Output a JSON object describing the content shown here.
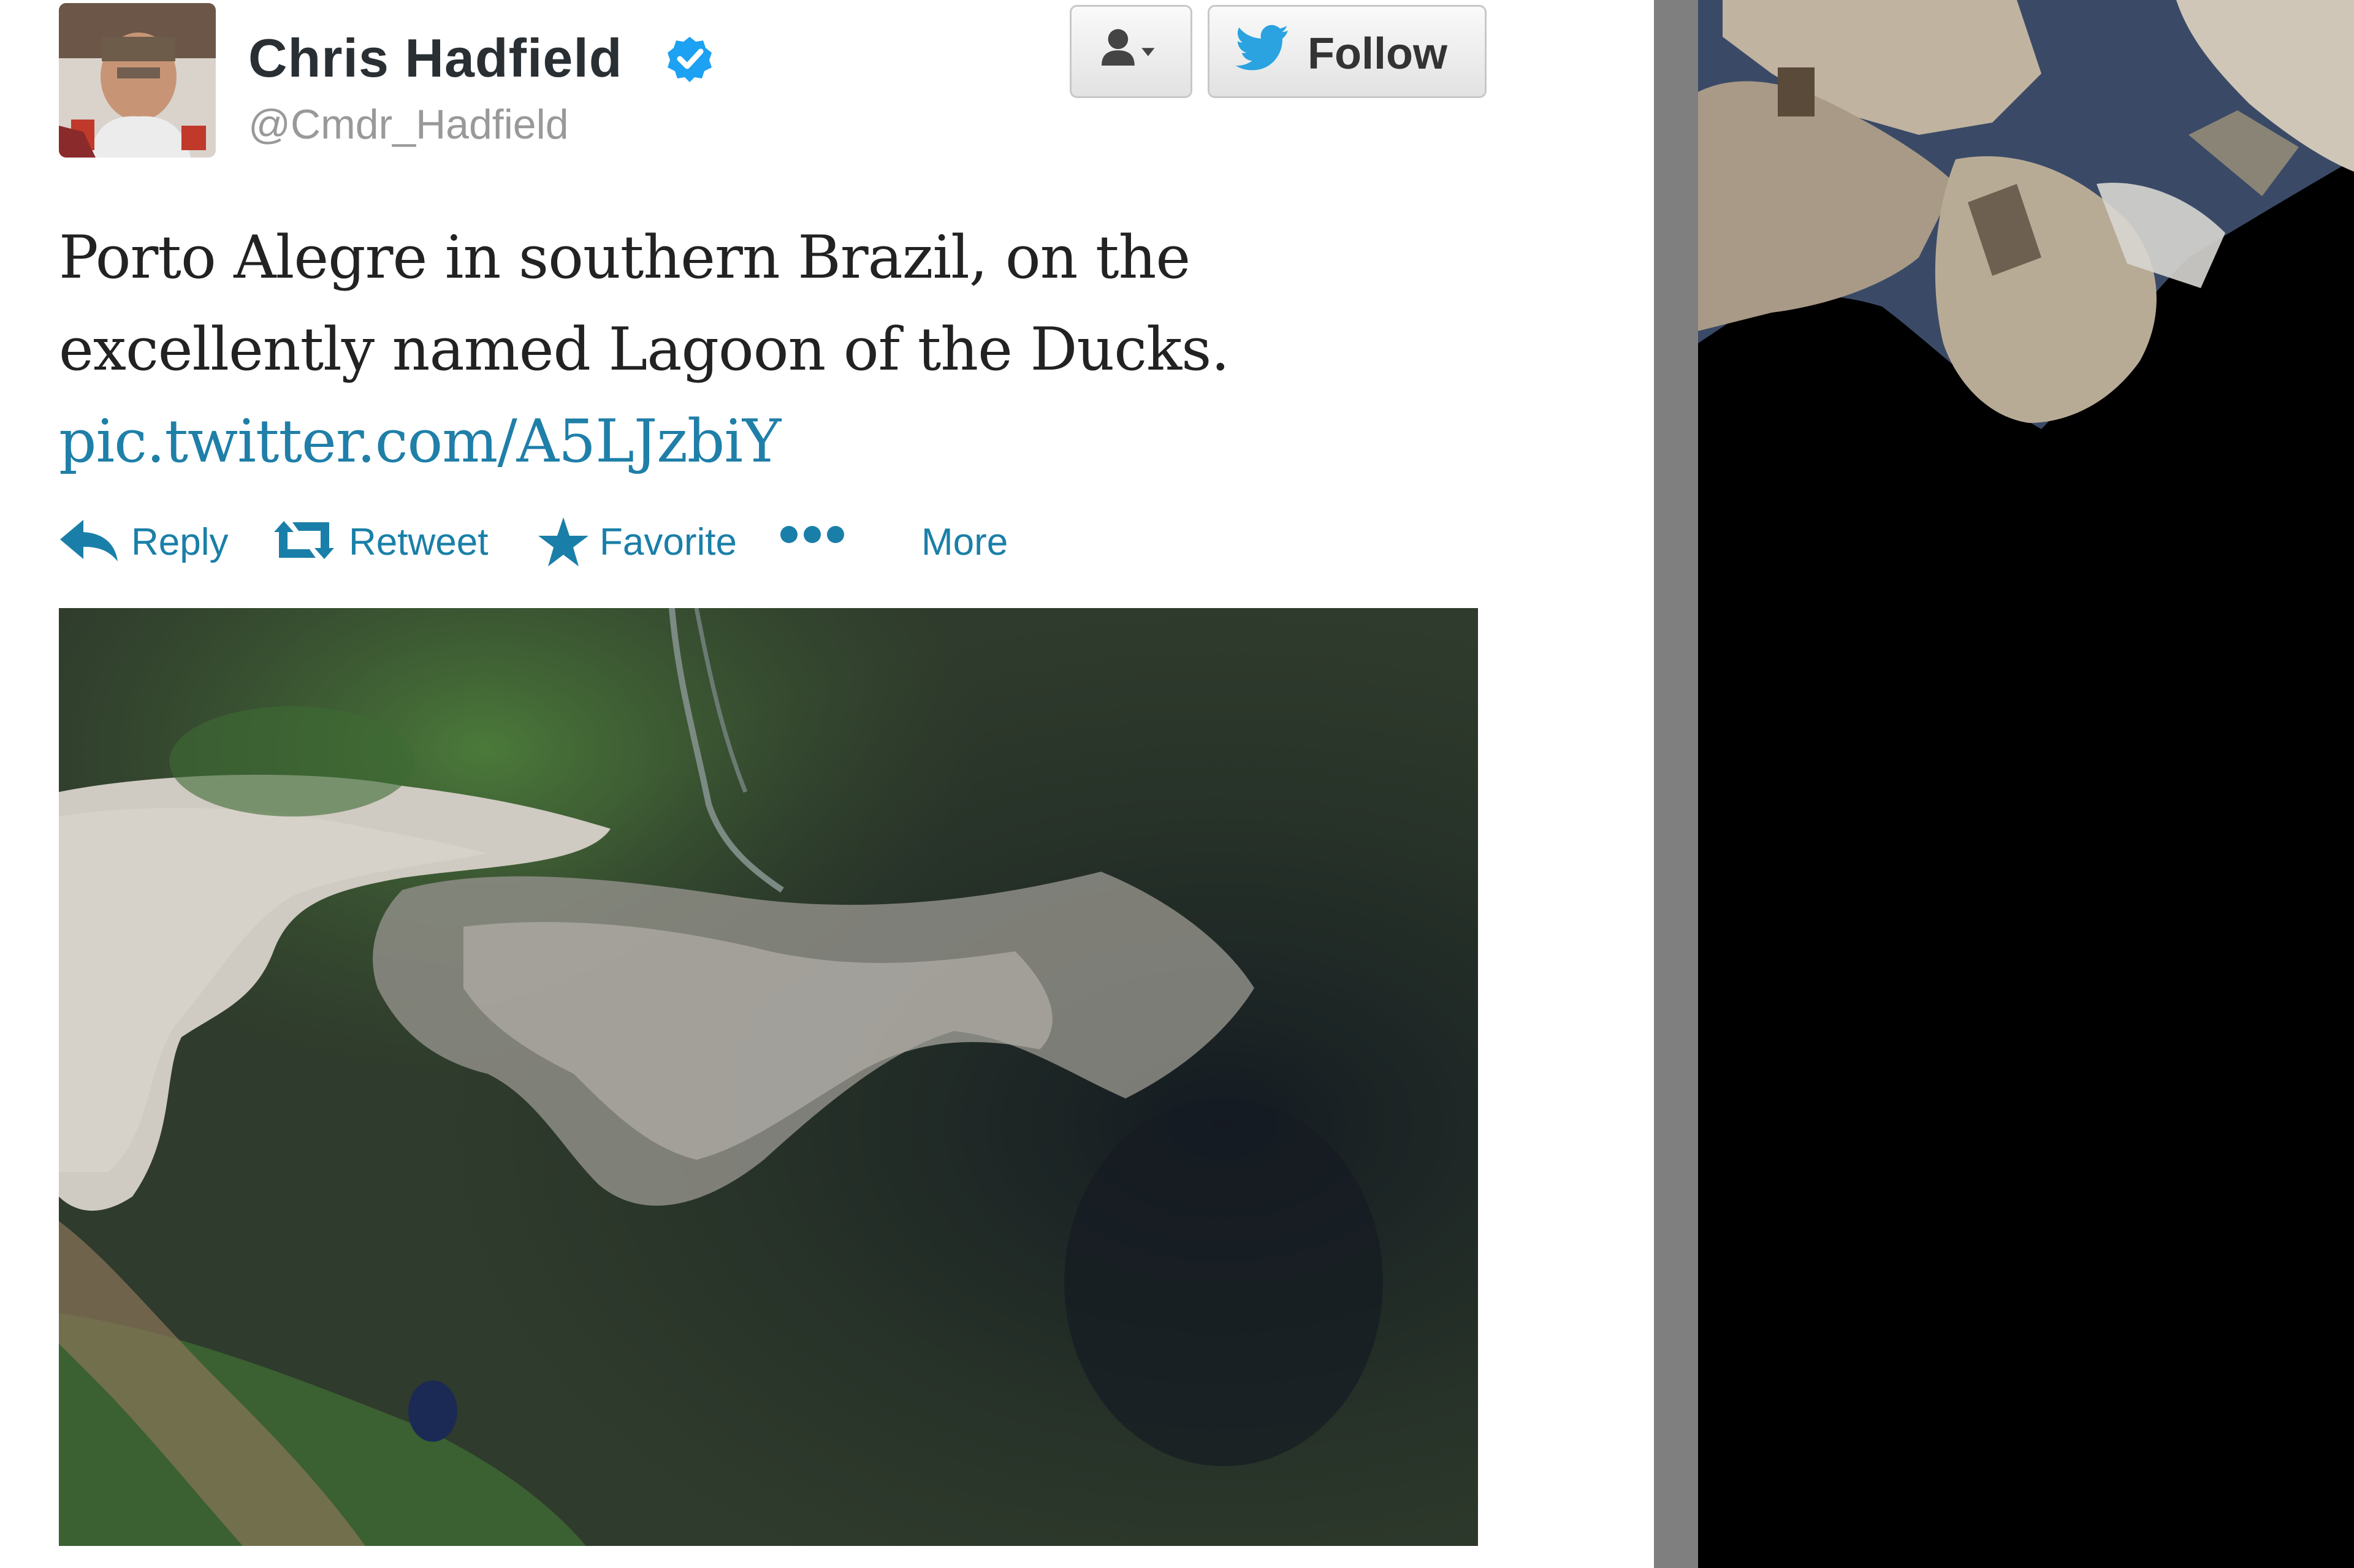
{
  "tweet": {
    "author_name": "Chris Hadfield",
    "author_handle": "@Cmdr_Hadfield",
    "verified": true,
    "text_line1": "Porto Alegre in southern Brazil, on the",
    "text_line2": "excellently named Lagoon of the Ducks.",
    "link_text": "pic.twitter.com/A5LJzbiY"
  },
  "header_buttons": {
    "user_actions_icon": "person-dropdown-icon",
    "follow_label": "Follow",
    "follow_icon": "twitter-bird-icon"
  },
  "actions": [
    {
      "label": "Reply",
      "icon": "reply-arrow-icon"
    },
    {
      "label": "Retweet",
      "icon": "retweet-icon"
    },
    {
      "label": "Favorite",
      "icon": "star-icon"
    },
    {
      "label": "More",
      "icon": "ellipsis-icon"
    }
  ],
  "media": {
    "photo_subject": "satellite-photo",
    "side_image_subject": "space-station-module"
  },
  "colors": {
    "link": "#1f7fa8",
    "action": "#1a7fa8",
    "verified": "#1da1f2",
    "twitter_blue": "#2aa3e0",
    "divider": "#7f7f7f"
  }
}
